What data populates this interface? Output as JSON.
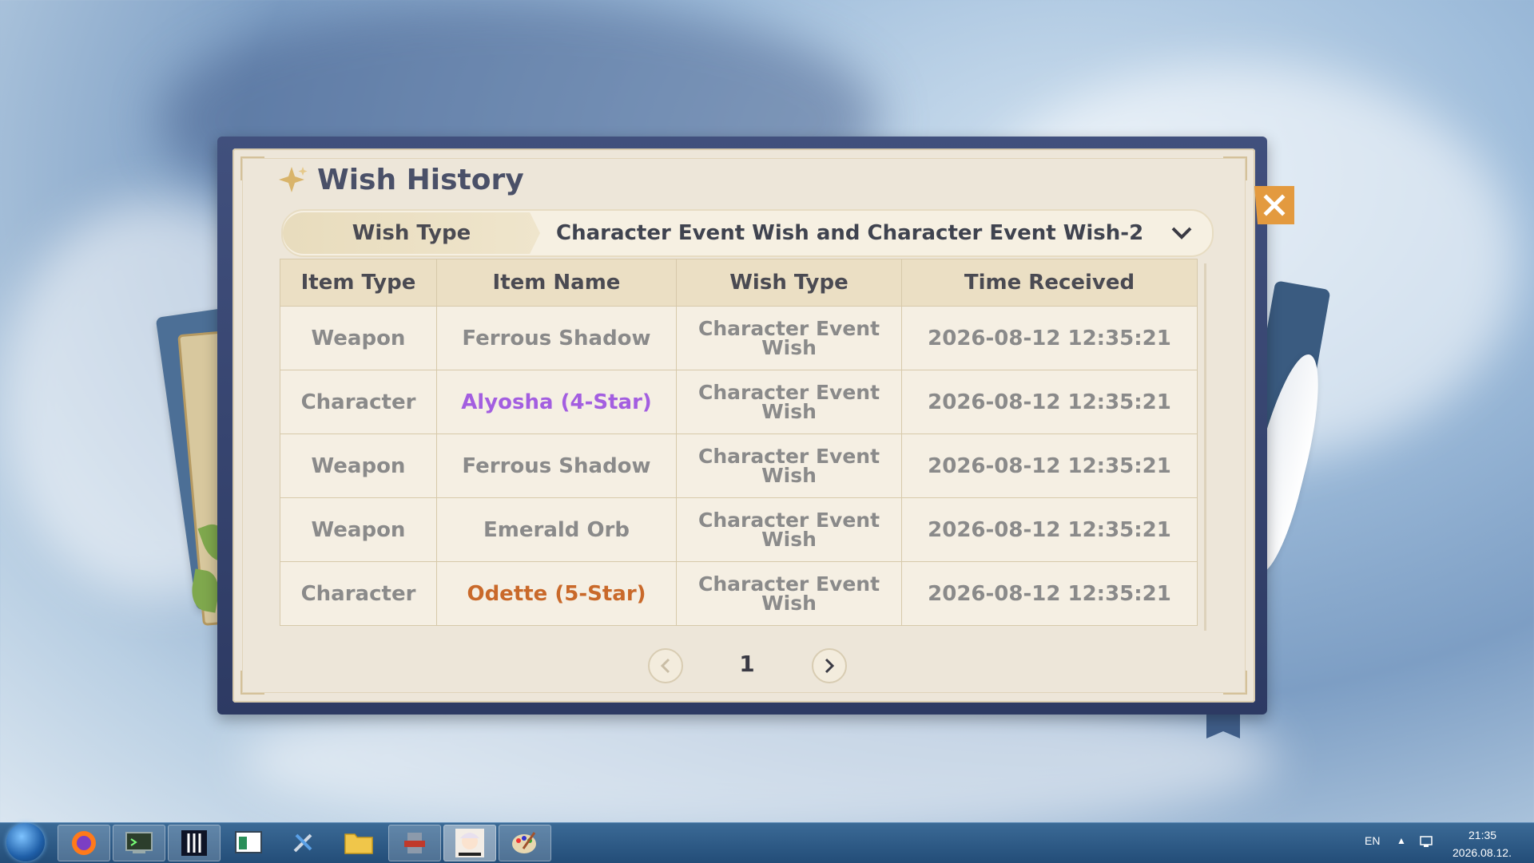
{
  "window": {
    "title": "Wish History"
  },
  "selector": {
    "label": "Wish Type",
    "value": "Character Event Wish and Character Event Wish-2"
  },
  "table": {
    "headers": [
      "Item Type",
      "Item Name",
      "Wish Type",
      "Time Received"
    ],
    "rows": [
      {
        "item_type": "Weapon",
        "item_name": "Ferrous Shadow",
        "wish_type": "Character Event Wish",
        "time": "2026-08-12 12:35:21",
        "rarity": "3"
      },
      {
        "item_type": "Character",
        "item_name": "Alyosha (4-Star)",
        "wish_type": "Character Event Wish",
        "time": "2026-08-12 12:35:21",
        "rarity": "4"
      },
      {
        "item_type": "Weapon",
        "item_name": "Ferrous Shadow",
        "wish_type": "Character Event Wish",
        "time": "2026-08-12 12:35:21",
        "rarity": "3"
      },
      {
        "item_type": "Weapon",
        "item_name": "Emerald Orb",
        "wish_type": "Character Event Wish",
        "time": "2026-08-12 12:35:21",
        "rarity": "3"
      },
      {
        "item_type": "Character",
        "item_name": "Odette (5-Star)",
        "wish_type": "Character Event Wish",
        "time": "2026-08-12 12:35:21",
        "rarity": "5"
      }
    ]
  },
  "pagination": {
    "current_page": "1"
  },
  "colors": {
    "four_star": "#a35ee0",
    "five_star": "#c9692a",
    "close_button": "#e39a3f"
  },
  "taskbar": {
    "apps": [
      "firefox-icon",
      "terminal-icon",
      "roman-numeral-app-icon",
      "window-app-icon",
      "tools-icon",
      "folder-icon",
      "settings-app-icon",
      "anime-game-icon",
      "paint-icon"
    ],
    "language": "EN",
    "time": "21:35",
    "date": "2026.08.12."
  }
}
